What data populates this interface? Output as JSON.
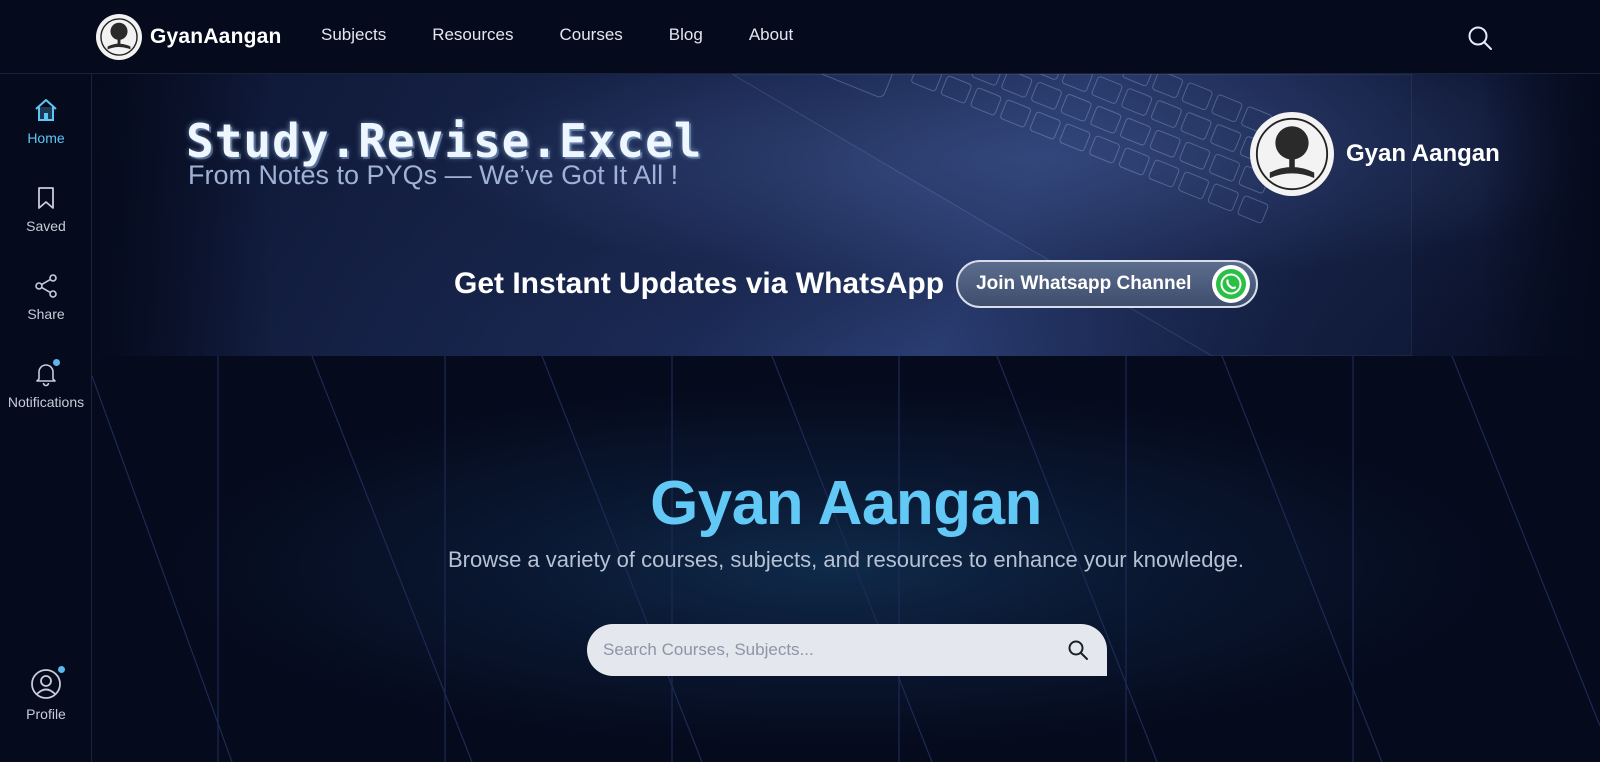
{
  "header": {
    "brand_name": "GyanAangan",
    "nav": [
      "Subjects",
      "Resources",
      "Courses",
      "Blog",
      "About"
    ]
  },
  "sidebar": {
    "items": [
      {
        "label": "Home",
        "icon": "home-icon",
        "active": true
      },
      {
        "label": "Saved",
        "icon": "bookmark-icon"
      },
      {
        "label": "Share",
        "icon": "share-icon"
      },
      {
        "label": "Notifications",
        "icon": "bell-icon",
        "badge": true
      },
      {
        "label": "Profile",
        "icon": "user-icon",
        "badge": true
      }
    ]
  },
  "banner": {
    "headline": "Study.Revise.Excel",
    "subline": "From Notes to PYQs — We’ve Got It All !",
    "brand_name": "Gyan Aangan",
    "whatsapp_text": "Get Instant Updates via WhatsApp",
    "whatsapp_button": "Join Whatsapp Channel"
  },
  "hero": {
    "title": "Gyan Aangan",
    "subtitle": "Browse a variety of courses, subjects, and resources to enhance your knowledge.",
    "search_placeholder": "Search Courses, Subjects..."
  },
  "colors": {
    "background": "#050a1c",
    "accent": "#62c9f6",
    "badge": "#5bb8ea"
  }
}
